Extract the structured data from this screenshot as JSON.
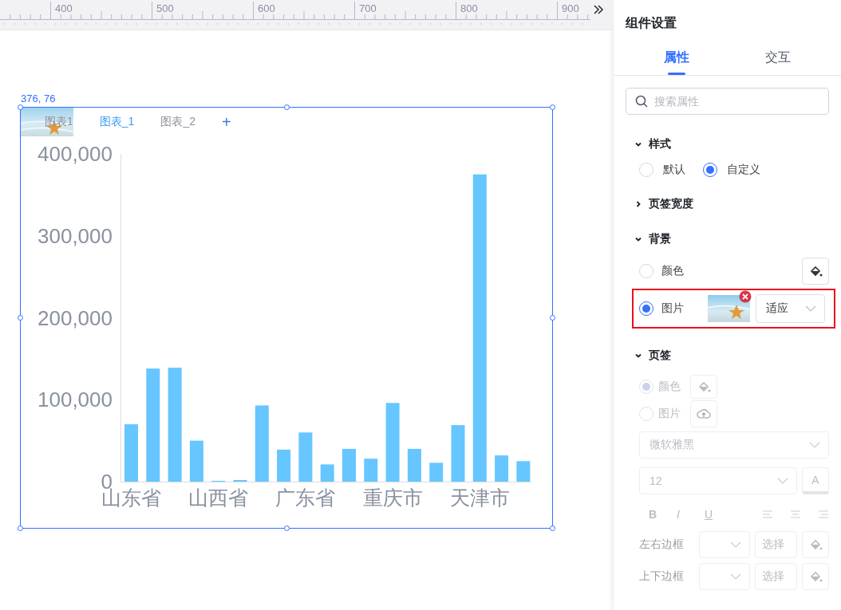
{
  "ruler": {
    "labels": [
      "400",
      "500",
      "600",
      "700",
      "800",
      "900"
    ]
  },
  "canvas": {
    "position_label": "376, 76",
    "widget": {
      "tabs": [
        {
          "label": "图表1",
          "selected": false
        },
        {
          "label": "图表_1",
          "selected": true
        },
        {
          "label": "图表_2",
          "selected": false
        }
      ],
      "add_tab": "+",
      "chart_data": {
        "type": "bar",
        "categories": [
          "山东省",
          null,
          null,
          null,
          "山西省",
          null,
          null,
          null,
          "广东省",
          null,
          null,
          null,
          "重庆市",
          null,
          null,
          null,
          "天津市",
          null,
          null
        ],
        "series": [
          {
            "color": "#66c6ff",
            "values": [
              70000,
              138000,
              139000,
              50000,
              1000,
              2000,
              93000,
              39000,
              60000,
              21000,
              40000,
              28000,
              96000,
              40000,
              23000,
              69000,
              375000,
              32000,
              25000
            ]
          }
        ],
        "ylim": [
          0,
          400000
        ],
        "yticks": [
          {
            "value": 0,
            "label": "0"
          },
          {
            "value": 100000,
            "label": "100,000"
          },
          {
            "value": 200000,
            "label": "200,000"
          },
          {
            "value": 300000,
            "label": "300,000"
          },
          {
            "value": 400000,
            "label": "400,000"
          }
        ]
      }
    }
  },
  "settings": {
    "title": "组件设置",
    "tabs": [
      {
        "label": "属性",
        "selected": true
      },
      {
        "label": "交互",
        "selected": false
      }
    ],
    "search": {
      "placeholder": "搜索属性"
    },
    "sections": [
      {
        "title": "样式",
        "expanded": true,
        "items": [
          {
            "kind": "options",
            "disabled": false,
            "options": [
              {
                "label": "默认",
                "selected": false
              },
              {
                "label": "自定义",
                "selected": true
              }
            ]
          }
        ]
      },
      {
        "title": "页签宽度",
        "expanded": false
      },
      {
        "title": "背景",
        "expanded": true,
        "items": [
          {
            "kind": "color-pick",
            "label": "颜色",
            "selected": false,
            "disabled": false,
            "highlighted": false
          },
          {
            "kind": "image-pick",
            "label": "图片",
            "selected": true,
            "fit": "适应",
            "disabled": false,
            "highlighted": true
          }
        ]
      },
      {
        "title": "页签",
        "expanded": true,
        "items": [
          {
            "kind": "color-inline",
            "label": "颜色",
            "selected": true,
            "disabled": true,
            "highlighted": false
          },
          {
            "kind": "upload-inline",
            "label": "图片",
            "selected": false,
            "disabled": true,
            "highlighted": false
          },
          {
            "kind": "select",
            "value": "微软雅黑",
            "disabled": true,
            "highlighted": false
          },
          {
            "kind": "size",
            "value": "12",
            "font_color_label": "A",
            "disabled": true
          },
          {
            "kind": "format",
            "buttons": [
              "B",
              "I",
              "U"
            ],
            "disabled": true
          },
          {
            "kind": "border",
            "label": "左右边框",
            "button": "选择",
            "disabled": true
          },
          {
            "kind": "border",
            "label": "上下边框",
            "button": "选择",
            "disabled": true
          }
        ]
      }
    ]
  }
}
